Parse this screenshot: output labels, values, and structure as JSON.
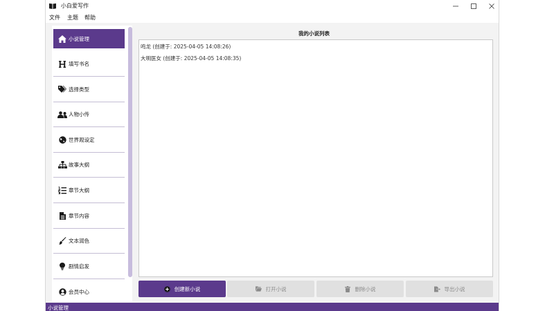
{
  "window": {
    "title": "小白爱写作",
    "accent_color": "#5b3a8c"
  },
  "menu": {
    "items": [
      {
        "label": "文件"
      },
      {
        "label": "主题"
      },
      {
        "label": "帮助"
      }
    ]
  },
  "sidebar": {
    "items": [
      {
        "label": "小说管理",
        "icon": "home-icon",
        "active": true
      },
      {
        "label": "填写书名",
        "icon": "heading-icon"
      },
      {
        "label": "选择类型",
        "icon": "tags-icon"
      },
      {
        "label": "人物小传",
        "icon": "users-icon"
      },
      {
        "label": "世界观设定",
        "icon": "globe-icon"
      },
      {
        "label": "故事大纲",
        "icon": "sitemap-icon"
      },
      {
        "label": "章节大纲",
        "icon": "list-ol-icon"
      },
      {
        "label": "章节内容",
        "icon": "file-text-icon"
      },
      {
        "label": "文本润色",
        "icon": "brush-icon"
      },
      {
        "label": "剧情启发",
        "icon": "lightbulb-icon"
      },
      {
        "label": "会员中心",
        "icon": "user-circle-icon"
      }
    ]
  },
  "novel_list": {
    "title": "我的小说列表",
    "items": [
      "鸣龙 (创建于: 2025-04-05 14:08:26)",
      "大明医女 (创建于: 2025-04-05 14:08:35)"
    ]
  },
  "actions": {
    "create": "创建新小说",
    "open": "打开小说",
    "delete": "删除小说",
    "export": "导出小说"
  },
  "status_bar": {
    "text": "小说管理"
  }
}
